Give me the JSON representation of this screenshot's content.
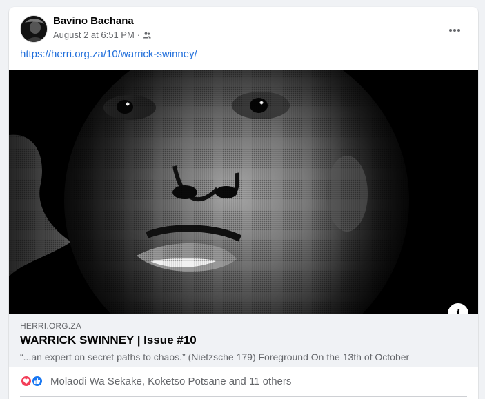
{
  "post": {
    "author": "Bavino Bachana",
    "timestamp": "August 2 at 6:51 PM",
    "separator": "·",
    "audience_icon": "friends-icon",
    "more_icon": "more-horizontal-icon",
    "link_text": "https://herri.org.za/10/warrick-swinney/"
  },
  "link_preview": {
    "domain": "HERRI.ORG.ZA",
    "title": "WARRICK SWINNEY | Issue #10",
    "description": "“...an expert on secret paths to chaos.” (Nietzsche 179) Foreground   On the 13th of October",
    "info_label": "i"
  },
  "reactions": {
    "icons": [
      "love-icon",
      "like-icon"
    ],
    "text": "Molaodi Wa Sekake, Koketso Potsane and 11 others"
  },
  "colors": {
    "link": "#216fdb",
    "like": "#1877f2",
    "love": "#f33e58",
    "secondary_text": "#65676b"
  }
}
